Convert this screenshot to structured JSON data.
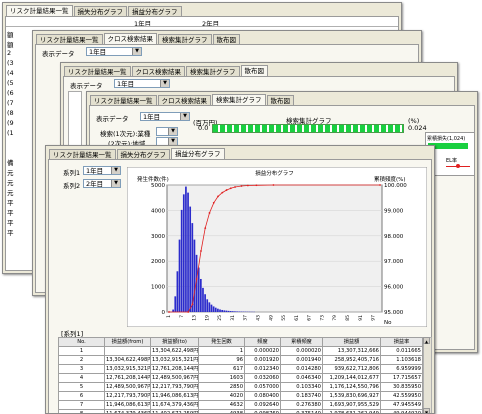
{
  "colors": {
    "bar": "#2b2bcc",
    "line": "#e02020",
    "green": "#19d040",
    "window_bg": "#ece9d8"
  },
  "win1": {
    "tabs": [
      "リスク計量結果一覧",
      "損失分布グラフ",
      "損益分布グラフ"
    ],
    "col_1": "1年目",
    "col_2": "2年目",
    "side_chars": [
      "額",
      "額",
      "2",
      "(3",
      "(4",
      "(5",
      "(6",
      "(7",
      "(8",
      "(9",
      "(1"
    ],
    "side_chars2": [
      "備",
      "元",
      "元",
      "元",
      "平",
      "平",
      "平",
      "平"
    ]
  },
  "win2": {
    "tabs": [
      "リスク計量結果一覧",
      "クロス検索結果",
      "検索集計グラフ",
      "散布図"
    ],
    "display_data_label": "表示データ",
    "display_data_value": "1年目"
  },
  "win3": {
    "tabs": [
      "リスク計量結果一覧",
      "クロス検索結果",
      "検索集計グラフ",
      "散布図"
    ],
    "display_data_label": "表示データ",
    "display_data_value": "1年目"
  },
  "win4": {
    "tabs": [
      "リスク計量結果一覧",
      "クロス検索結果",
      "検索集計グラフ",
      "散布図"
    ],
    "display_data_label": "表示データ",
    "display_data_value": "1年目",
    "search_axis1": "検索(1次元):業種",
    "search_axis2": "(2次元):地域",
    "unit_left": "(百万円)",
    "unit_left_bottom": "0.0",
    "unit_left_bottom2": "6",
    "chart_title": "検索集計グラフ",
    "unit_right": "(%)",
    "right_top": "0.024",
    "right_bottom": "0",
    "legend_label": "累積損失(1,024)",
    "legend_tail": "EL率"
  },
  "win5": {
    "tabs": [
      "リスク計量結果一覧",
      "損失分布グラフ",
      "損益分布グラフ"
    ],
    "series1_label": "系列1",
    "series1_value": "1年目",
    "series2_label": "系列2",
    "series2_value": "2年目",
    "series_section_label": "[系列1]",
    "table": {
      "headers": [
        "No.",
        "損益額(from)",
        "損益額(to)",
        "発生回数",
        "頻度",
        "累積頻度",
        "損益額",
        "損益率"
      ],
      "rows": [
        [
          "1",
          "",
          "13,304,622,498円",
          "1",
          "0.000020",
          "0.000020",
          "13,307,312,666",
          "0.011665"
        ],
        [
          "2",
          "13,304,622,498円",
          "13,032,915,321円",
          "96",
          "0.001920",
          "0.001940",
          "258,952,405,716",
          "1.103618"
        ],
        [
          "3",
          "13,032,915,321円",
          "12,761,208,144円",
          "617",
          "0.012340",
          "0.014280",
          "939,622,712,806",
          "6.959999"
        ],
        [
          "4",
          "12,761,208,144円",
          "12,489,500,967円",
          "1603",
          "0.032060",
          "0.046340",
          "1,209,144,012,677",
          "17.715657"
        ],
        [
          "5",
          "12,489,500,967円",
          "12,217,793,790円",
          "2850",
          "0.057000",
          "0.103340",
          "1,176,124,550,796",
          "30.835950"
        ],
        [
          "6",
          "12,217,793,790円",
          "11,946,086,613円",
          "4020",
          "0.080400",
          "0.183740",
          "1,539,830,696,927",
          "42.559950"
        ],
        [
          "7",
          "11,946,086,613円",
          "11,674,379,436円",
          "4632",
          "0.092640",
          "0.276380",
          "1,693,907,955,529",
          "47.945549"
        ],
        [
          "8",
          "11,674,379,436円",
          "11,402,672,259円",
          "4938",
          "0.098760",
          "0.375140",
          "1,978,631,262,949",
          "49.944920"
        ],
        [
          "9",
          "11,402,672,259円",
          "",
          "",
          "",
          "",
          "",
          ""
        ]
      ]
    }
  },
  "chart_data": {
    "type": "bar",
    "title": "損益分布グラフ",
    "ylabel_left": "発生件数(件)",
    "ylabel_right": "累積頻度(%)",
    "xlabel": "No",
    "y_left_ticks": [
      "5000",
      "4000",
      "3000",
      "2000",
      "1000",
      "0"
    ],
    "y_right_ticks": [
      "100.000",
      "99.000",
      "98.000",
      "97.000",
      "96.000",
      "95.000"
    ],
    "x_ticks": [
      "1",
      "7",
      "13",
      "19",
      "25",
      "31",
      "37",
      "43",
      "49",
      "55",
      "61",
      "67",
      "73",
      "79",
      "85",
      "91",
      "97"
    ],
    "ylim_left": [
      0,
      5000
    ],
    "ylim_right": [
      95,
      100
    ],
    "series": [
      {
        "name": "発生件数",
        "type": "bar",
        "values": [
          1,
          96,
          617,
          1603,
          2850,
          4020,
          4632,
          4938,
          4700,
          4150,
          3500,
          2850,
          2250,
          1750,
          1300,
          950,
          700,
          500,
          380,
          290,
          220,
          170,
          130,
          100,
          80,
          65,
          55,
          45,
          38,
          32,
          27,
          23,
          20,
          17,
          15,
          13,
          11,
          10,
          9,
          8
        ]
      },
      {
        "name": "累積頻度",
        "type": "line",
        "x": [
          1,
          10,
          12,
          14,
          16,
          18,
          20,
          22,
          24,
          26,
          28,
          30,
          32,
          35,
          38,
          42,
          50,
          100
        ],
        "values": [
          95,
          95,
          95.3,
          96.3,
          97.4,
          98.3,
          98.9,
          99.3,
          99.55,
          99.7,
          99.8,
          99.87,
          99.92,
          99.96,
          99.98,
          99.99,
          100,
          100
        ]
      }
    ]
  }
}
